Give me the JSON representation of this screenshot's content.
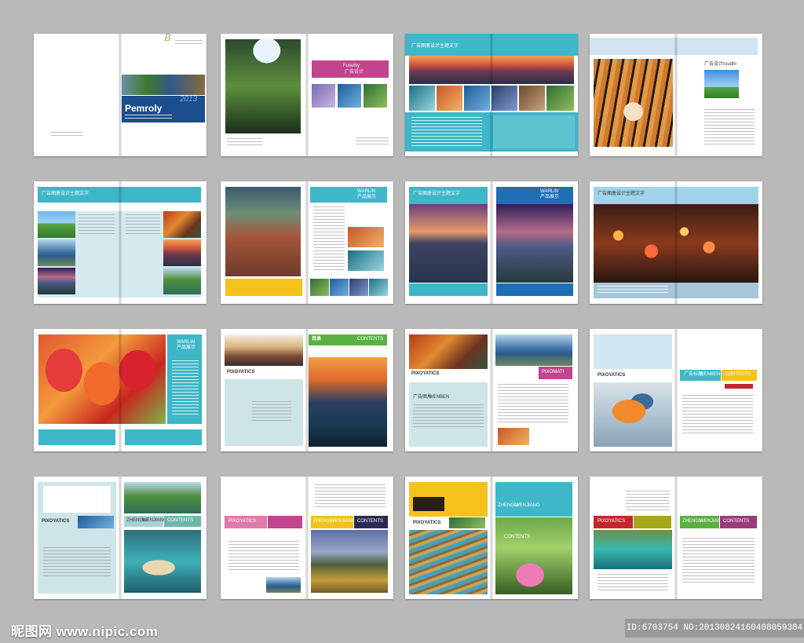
{
  "spreads": [
    {
      "id": "s1",
      "texts": {
        "brand": "Pemroly",
        "year": "2013",
        "script": "B"
      }
    },
    {
      "id": "s2",
      "texts": {
        "tag": "Fusuhiy",
        "sub": "广告设计"
      }
    },
    {
      "id": "s3",
      "texts": {
        "header": "广告图册设计主题文字"
      }
    },
    {
      "id": "s4",
      "texts": {
        "title": "广告设计",
        "subtitle": "ruudhr"
      }
    },
    {
      "id": "s5",
      "texts": {
        "header": "广告图册设计主题文字"
      }
    },
    {
      "id": "s6",
      "texts": {
        "tag": "WARLIN",
        "sub": "产品展示"
      }
    },
    {
      "id": "s7",
      "texts": {
        "header": "广告图册设计主题文字",
        "tag": "WARLIN",
        "sub": "产品展示"
      }
    },
    {
      "id": "s8",
      "texts": {
        "header": "广告图册设计主题文字"
      }
    },
    {
      "id": "s9",
      "texts": {
        "tag": "WARLIN",
        "sub": "产品展示"
      }
    },
    {
      "id": "s10",
      "texts": {
        "brand": "PIXOYATICS",
        "toc": "目录",
        "contents": "CONTENTS"
      }
    },
    {
      "id": "s11",
      "texts": {
        "brand": "PIXOYATICS",
        "sub": "广告图片",
        "sub2": "WENBEN",
        "right": "PIXOMATI"
      }
    },
    {
      "id": "s12",
      "texts": {
        "brand": "PIXOYATICS",
        "sub": "广告标题",
        "sub2": "WENBEN",
        "contents": "CONTENTS"
      }
    },
    {
      "id": "s13",
      "texts": {
        "brand": "PIXOYATICS",
        "sub": "ZHENGLI",
        "sub2": "WENJIANG",
        "contents": "CONTENTS"
      }
    },
    {
      "id": "s14",
      "texts": {
        "brand": "PIXOYATICS",
        "sub": "ZHENGLI",
        "sub2": "WENJIANG",
        "contents": "CONTENTS"
      }
    },
    {
      "id": "s15",
      "texts": {
        "brand": "PIXOYATICS",
        "sub": "ZHENGLI",
        "sub2": "WENJIANG",
        "contents": "CONTENTS"
      }
    },
    {
      "id": "s16",
      "texts": {
        "brand": "PIXOYATICS",
        "sub": "ZHENGLI",
        "sub2": "WENJIANG",
        "contents": "CONTENTS"
      }
    }
  ],
  "watermark": {
    "site_cn": "昵图网",
    "site_url": "www.nipic.com",
    "id_text": "ID:6703754 NO:20130824160408059384"
  },
  "colors": {
    "background": "#b9b9b9",
    "teal": "#3eb7c8",
    "navy": "#1c4d8c",
    "magenta": "#c0458e",
    "yellow": "#f4c21b",
    "green": "#5bb043",
    "red": "#c3262d",
    "pale_teal": "#cde5e6"
  }
}
